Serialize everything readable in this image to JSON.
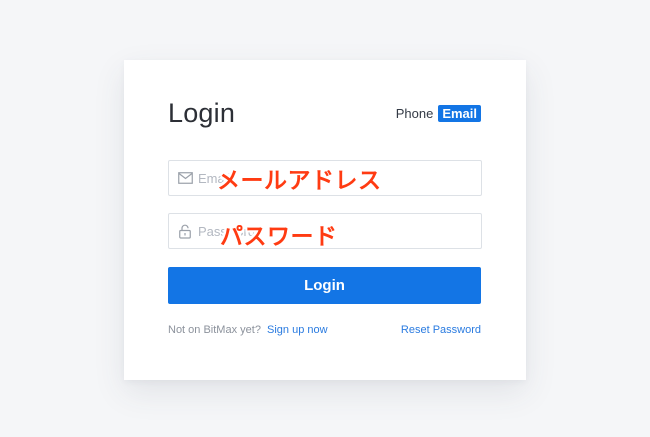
{
  "login": {
    "title": "Login",
    "method_phone": "Phone",
    "method_email": "Email",
    "email_placeholder": "Email",
    "password_placeholder": "Password",
    "submit_label": "Login"
  },
  "footer": {
    "prompt": "Not on BitMax yet?",
    "signup_link": "Sign up now",
    "reset_link": "Reset Password"
  },
  "annotations": {
    "email_label": "メールアドレス",
    "password_label": "パスワード"
  },
  "icons": {
    "email_field": "envelope-icon",
    "password_field": "lock-icon"
  },
  "colors": {
    "primary": "#1375e5",
    "annotation": "#ff3b12",
    "background": "#f5f6f8"
  }
}
